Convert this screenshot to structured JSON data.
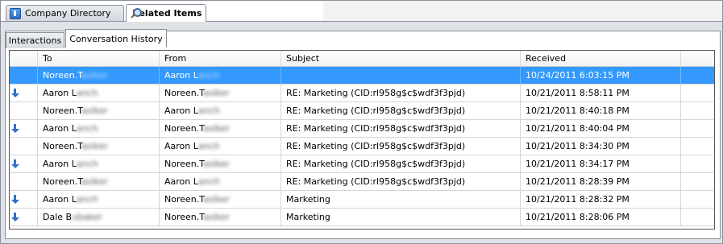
{
  "top_tabs": [
    {
      "label": "Company Directory",
      "icon": "directory-icon"
    },
    {
      "label": "Related Items",
      "icon": "search-icon"
    }
  ],
  "sub_tabs": [
    {
      "label": "Interactions"
    },
    {
      "label": "Conversation History"
    }
  ],
  "columns": [
    "To",
    "From",
    "Subject",
    "Received"
  ],
  "rows": [
    {
      "direction": "none",
      "to": [
        "Noreen.T",
        "aslker"
      ],
      "from": [
        "Aaron L",
        "anch"
      ],
      "subject": "",
      "received": "10/24/2011 6:03:15 PM",
      "selected": true
    },
    {
      "direction": "incoming",
      "to": [
        "Aaron L",
        "anch"
      ],
      "from": [
        "Noreen.T",
        "aslker"
      ],
      "subject": "RE: Marketing (CID:rl958g$c$wdf3f3pjd)",
      "received": "10/21/2011 8:58:11 PM",
      "selected": false
    },
    {
      "direction": "none",
      "to": [
        "Noreen.T",
        "aslker"
      ],
      "from": [
        "Aaron L",
        "anch"
      ],
      "subject": "RE: Marketing (CID:rl958g$c$wdf3f3pjd)",
      "received": "10/21/2011 8:40:18 PM",
      "selected": false
    },
    {
      "direction": "incoming",
      "to": [
        "Aaron L",
        "anch"
      ],
      "from": [
        "Noreen.T",
        "aslker"
      ],
      "subject": "RE: Marketing (CID:rl958g$c$wdf3f3pjd)",
      "received": "10/21/2011 8:40:04 PM",
      "selected": false
    },
    {
      "direction": "none",
      "to": [
        "Noreen.T",
        "aslker"
      ],
      "from": [
        "Aaron L",
        "anch"
      ],
      "subject": "RE: Marketing (CID:rl958g$c$wdf3f3pjd)",
      "received": "10/21/2011 8:34:30 PM",
      "selected": false
    },
    {
      "direction": "incoming",
      "to": [
        "Aaron L",
        "anch"
      ],
      "from": [
        "Noreen.T",
        "aslker"
      ],
      "subject": "RE: Marketing (CID:rl958g$c$wdf3f3pjd)",
      "received": "10/21/2011 8:34:17 PM",
      "selected": false
    },
    {
      "direction": "none",
      "to": [
        "Noreen.T",
        "aslker"
      ],
      "from": [
        "Aaron L",
        "anch"
      ],
      "subject": "RE: Marketing (CID:rl958g$c$wdf3f3pjd)",
      "received": "10/21/2011 8:28:39 PM",
      "selected": false
    },
    {
      "direction": "incoming",
      "to": [
        "Aaron L",
        "anch"
      ],
      "from": [
        "Noreen.T",
        "aslker"
      ],
      "subject": "Marketing",
      "received": "10/21/2011 8:28:32 PM",
      "selected": false
    },
    {
      "direction": "incoming",
      "to": [
        "Dale B",
        "ubaker"
      ],
      "from": [
        "Noreen.T",
        "aslker"
      ],
      "subject": "Marketing",
      "received": "10/21/2011 8:28:06 PM",
      "selected": false
    }
  ],
  "colors": {
    "selection": "#3399ff",
    "arrow": "#2f6fd1"
  }
}
